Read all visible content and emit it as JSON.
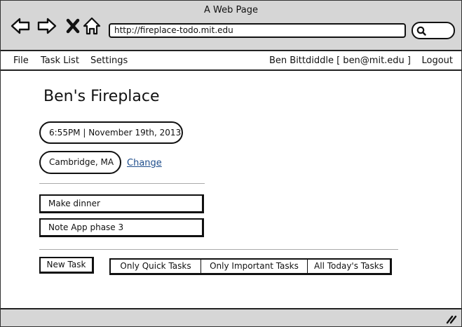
{
  "window": {
    "title": "A Web Page"
  },
  "browser": {
    "url": "http://fireplace-todo.mit.edu",
    "icons": [
      "back-arrow-icon",
      "forward-arrow-icon",
      "close-x-icon",
      "home-icon",
      "search-icon",
      "resize-grip-icon"
    ]
  },
  "menu": {
    "file": "File",
    "task_list": "Task List",
    "settings": "Settings",
    "user": "Ben Bittdiddle [ ben@mit.edu ]",
    "logout": "Logout"
  },
  "main": {
    "title": "Ben's Fireplace",
    "datetime": "6:55PM | November 19th, 2013",
    "location": "Cambridge, MA",
    "change_label": "Change",
    "tasks": [
      {
        "label": "Make dinner"
      },
      {
        "label": "Note App phase 3"
      }
    ],
    "new_task_label": "New Task",
    "filters": [
      {
        "label": "Only Quick Tasks"
      },
      {
        "label": "Only Important Tasks"
      },
      {
        "label": "All Today's Tasks"
      }
    ]
  },
  "colors": {
    "chrome_bg": "#d6d6d6",
    "link": "#1e4d8c",
    "border": "#111111"
  }
}
